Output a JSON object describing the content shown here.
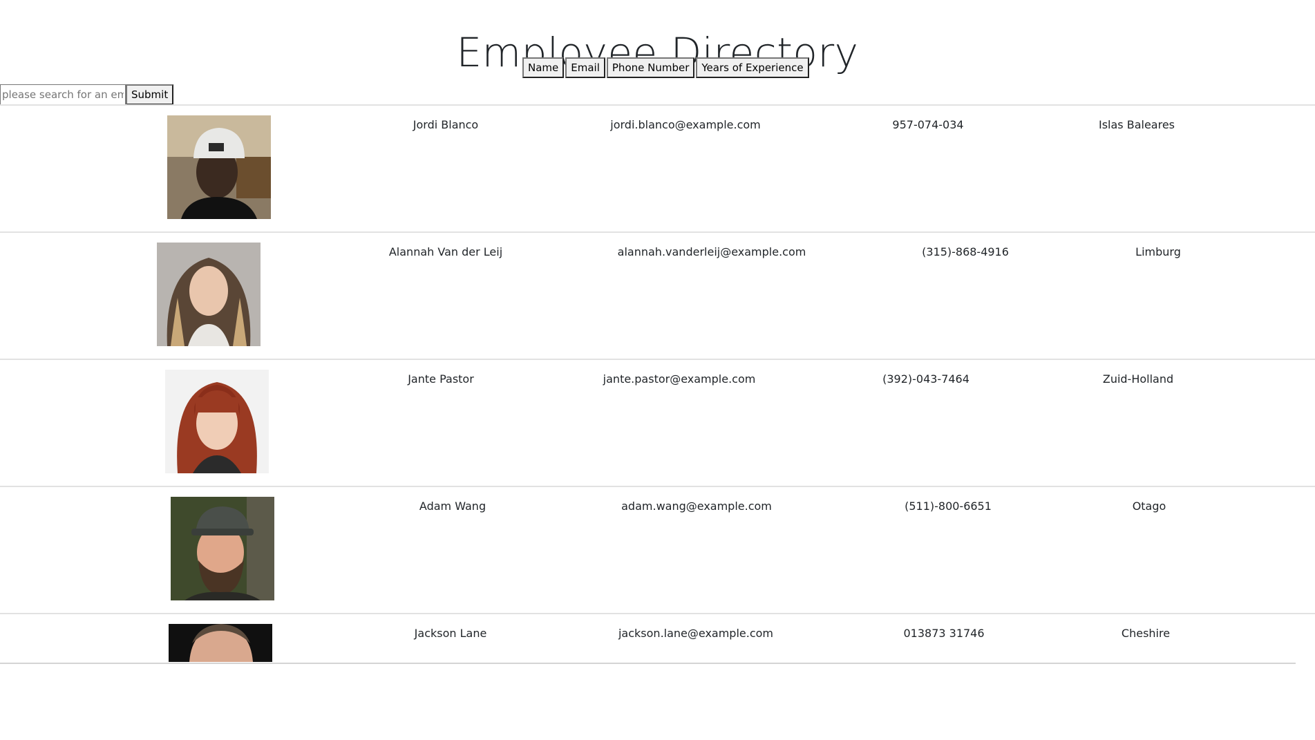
{
  "page": {
    "title": "Employee Directory"
  },
  "sort_buttons": [
    {
      "label": "Name"
    },
    {
      "label": "Email"
    },
    {
      "label": "Phone Number"
    },
    {
      "label": "Years of Experience"
    }
  ],
  "search": {
    "placeholder": "please search for an employee",
    "submit_label": "Submit"
  },
  "employees": [
    {
      "name": "Jordi Blanco",
      "email": "jordi.blanco@example.com",
      "phone": "957-074-034",
      "location": "Islas Baleares"
    },
    {
      "name": "Alannah Van der Leij",
      "email": "alannah.vanderleij@example.com",
      "phone": "(315)-868-4916",
      "location": "Limburg"
    },
    {
      "name": "Jante Pastor",
      "email": "jante.pastor@example.com",
      "phone": "(392)-043-7464",
      "location": "Zuid-Holland"
    },
    {
      "name": "Adam Wang",
      "email": "adam.wang@example.com",
      "phone": "(511)-800-6651",
      "location": "Otago"
    },
    {
      "name": "Jackson Lane",
      "email": "jackson.lane@example.com",
      "phone": "013873 31746",
      "location": "Cheshire"
    }
  ]
}
